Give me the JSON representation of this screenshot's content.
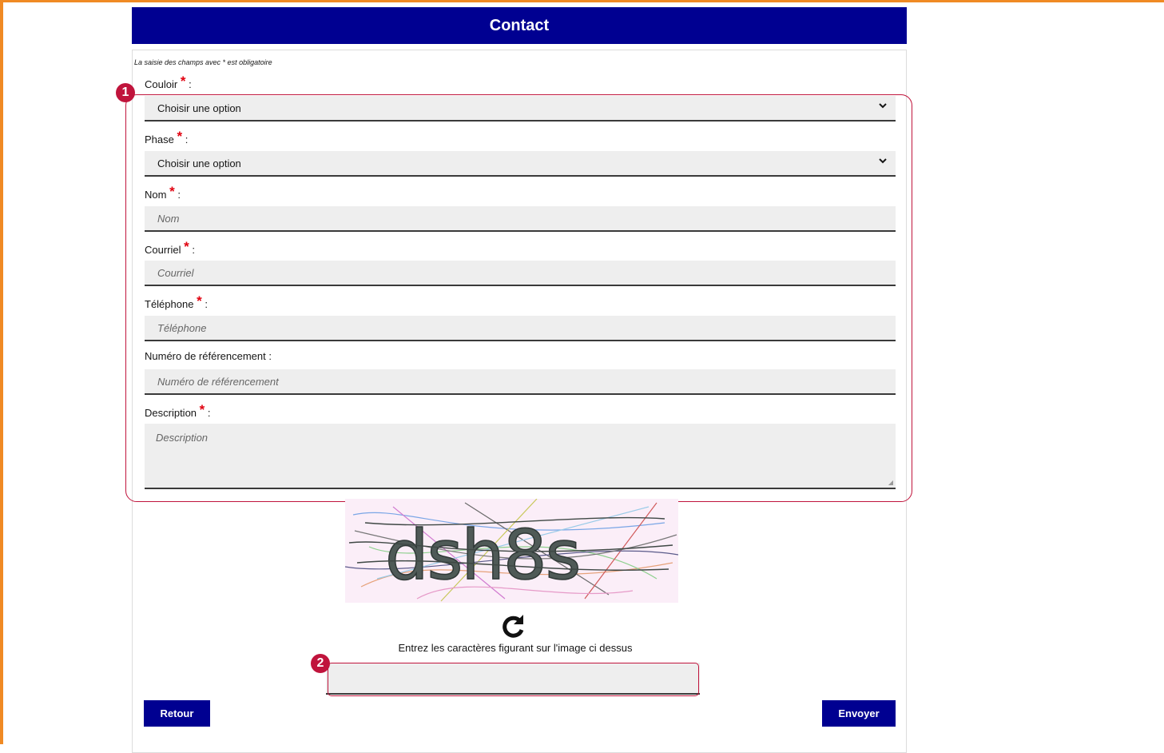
{
  "header": {
    "title": "Contact"
  },
  "form": {
    "required_note": "La saisie des champs avec * est obligatoire",
    "required_marker": "*",
    "colon": ":",
    "fields": [
      {
        "label": "Couloir",
        "required": true,
        "type": "select",
        "value": "Choisir une option"
      },
      {
        "label": "Phase",
        "required": true,
        "type": "select",
        "value": "Choisir une option"
      },
      {
        "label": "Nom",
        "required": true,
        "type": "input",
        "placeholder": "Nom"
      },
      {
        "label": "Courriel",
        "required": true,
        "type": "input",
        "placeholder": "Courriel"
      },
      {
        "label": "Téléphone",
        "required": true,
        "type": "input",
        "placeholder": "Téléphone"
      },
      {
        "label": "Numéro de référencement",
        "required": false,
        "type": "input",
        "placeholder": "Numéro de référencement"
      },
      {
        "label": "Description",
        "required": true,
        "type": "textarea",
        "placeholder": "Description"
      }
    ]
  },
  "captcha": {
    "image_text": "dsh8s",
    "hint": "Entrez les caractères figurant sur l'image ci dessus",
    "input_value": ""
  },
  "annotations": {
    "badge1": "1",
    "badge2": "2",
    "highlight_color": "#c0143c"
  },
  "buttons": {
    "back": "Retour",
    "submit": "Envoyer"
  },
  "colors": {
    "primary": "#000091",
    "required": "#e1000f",
    "frame": "#f08a24"
  }
}
